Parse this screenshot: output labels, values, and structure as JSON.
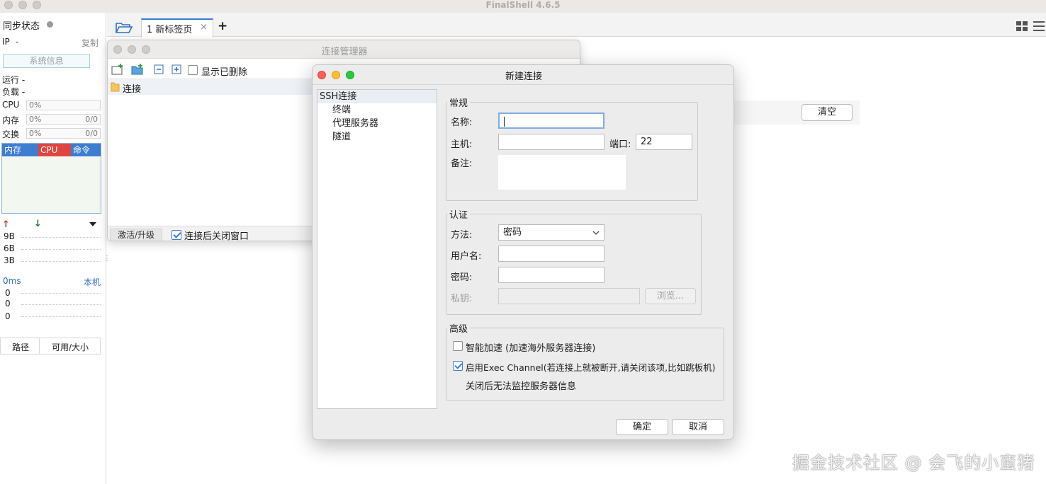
{
  "app": {
    "title": "FinalShell 4.6.5"
  },
  "left_panel": {
    "sync_status": "同步状态",
    "ip_label": "IP",
    "ip_value": "-",
    "copy": "复制",
    "sys_info": "系统信息",
    "running": "运行 -",
    "load": "负载 -",
    "metrics": [
      {
        "name": "CPU",
        "left": "0%",
        "right": ""
      },
      {
        "name": "内存",
        "left": "0%",
        "right": "0/0"
      },
      {
        "name": "交换",
        "left": "0%",
        "right": "0/0"
      }
    ],
    "process_headers": [
      {
        "label": "内存",
        "color": "#3d7dd2"
      },
      {
        "label": "CPU",
        "color": "#e0443e"
      },
      {
        "label": "命令",
        "color": "#3d7dd2"
      }
    ],
    "net_ticks": [
      "9B",
      "6B",
      "3B"
    ],
    "latency_label": "0ms",
    "latency_host": "本机",
    "latency_ticks": [
      "0",
      "0",
      "0"
    ],
    "disk_cols": [
      "路径",
      "可用/大小"
    ]
  },
  "tabs": [
    {
      "label": "1 新标签页",
      "close": "×"
    }
  ],
  "tab_add": "+",
  "clear_button": "清空",
  "conn_manager": {
    "title": "连接管理器",
    "show_deleted": "显示已删除",
    "tree_root": "连接",
    "activate": "激活/升级",
    "close_after_connect": "连接后关闭窗口"
  },
  "new_conn": {
    "title": "新建连接",
    "sidebar": {
      "root": "SSH连接",
      "children": [
        "终端",
        "代理服务器",
        "隧道"
      ]
    },
    "general": {
      "legend": "常规",
      "name_label": "名称:",
      "name_value": "",
      "host_label": "主机:",
      "host_value": "",
      "port_label": "端口:",
      "port_value": "22",
      "note_label": "备注:"
    },
    "auth": {
      "legend": "认证",
      "method_label": "方法:",
      "method_value": "密码",
      "user_label": "用户名:",
      "password_label": "密码:",
      "key_label": "私钥:",
      "browse": "浏览..."
    },
    "advanced": {
      "legend": "高级",
      "smart_accel": "智能加速 (加速海外服务器连接)",
      "exec_channel": "启用Exec Channel(若连接上就被断开,请关闭该项,比如跳板机)",
      "exec_note": "关闭后无法监控服务器信息"
    },
    "ok": "确定",
    "cancel": "取消"
  },
  "watermark": "掘金技术社区 @ 会飞的小蛮猪"
}
